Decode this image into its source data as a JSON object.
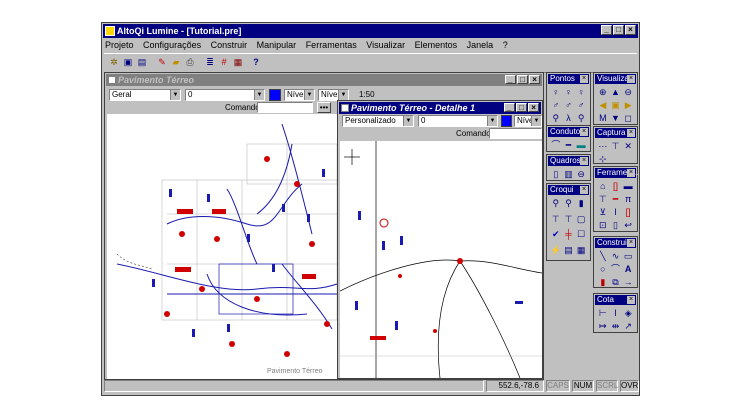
{
  "app": {
    "title": "AltoQi Lumine - [Tutorial.pre]"
  },
  "menu": [
    "Projeto",
    "Configurações",
    "Construir",
    "Manipular",
    "Ferramentas",
    "Visualizar",
    "Elementos",
    "Janela",
    "?"
  ],
  "toolbar_icons": [
    "new-icon",
    "open-icon",
    "save-icon",
    "pen-icon",
    "folder-icon",
    "print-icon",
    "layers-icon",
    "grid-icon",
    "properties-icon",
    "help-icon"
  ],
  "window1": {
    "title": "Pavimento Térreo",
    "layer_select": "Geral",
    "value_select": "0",
    "level1": "Nível",
    "level2": "Nível",
    "scale": "1:50",
    "command_label": "Comando",
    "floor_label": "Pavimento Térreo"
  },
  "window2": {
    "title": "Pavimento Térreo - Detalhe 1",
    "layer_select": "Personalizado",
    "value_select": "0",
    "level": "Nível",
    "command_label": "Comando"
  },
  "palettes": [
    {
      "title": "Pontos",
      "icons": [
        "point-icon",
        "point-icon",
        "point-icon",
        "point-icon",
        "point-icon",
        "point-icon",
        "point-icon",
        "point-icon",
        "point-icon",
        "point-icon",
        "point-icon",
        "point-icon"
      ]
    },
    {
      "title": "Visualiza...",
      "icons": [
        "zoom-in-icon",
        "arrow-up-icon",
        "zoom-out-icon",
        "arrow-left-icon",
        "zoom-window-icon",
        "arrow-right-icon",
        "pan-icon",
        "arrow-down-icon",
        "zoom-fit-icon"
      ]
    },
    {
      "title": "Condutos",
      "icons": [
        "conduit-icon",
        "conduit-icon",
        "conduit-icon"
      ]
    },
    {
      "title": "Captura",
      "icons": [
        "snap-icon",
        "snap-icon",
        "snap-icon"
      ]
    },
    {
      "title": "Quadros",
      "icons": [
        "panel-icon",
        "panel-icon",
        "panel-icon"
      ]
    },
    {
      "title": "Ferramen...",
      "icons": [
        "tool-icon",
        "tool-icon",
        "tool-icon",
        "tool-icon",
        "tool-icon",
        "tool-icon",
        "tool-icon",
        "tool-icon",
        "tool-icon",
        "tool-icon",
        "tool-icon",
        "tool-icon"
      ]
    },
    {
      "title": "Croqui",
      "icons": [
        "sketch-icon",
        "sketch-icon",
        "sketch-icon",
        "sketch-icon",
        "sketch-icon",
        "sketch-icon",
        "sketch-icon",
        "sketch-icon",
        "sketch-icon",
        "sketch-icon",
        "sketch-icon",
        "sketch-icon"
      ]
    },
    {
      "title": "Construir",
      "icons": [
        "line-icon",
        "polyline-icon",
        "rectangle-icon",
        "circle-icon",
        "arc-icon",
        "text-icon",
        "fill-icon",
        "copy-icon",
        "arrow-icon"
      ]
    },
    {
      "title": "Cota",
      "icons": [
        "dimension-icon",
        "dimension-icon",
        "dimension-icon",
        "dimension-icon",
        "dimension-icon",
        "dimension-icon"
      ]
    }
  ],
  "status": {
    "coords": "552.6,-78.6",
    "caps": "CAPS",
    "num": "NUM",
    "scrl": "SCRL",
    "ovr": "OVR"
  },
  "colors": {
    "title_active": "#000080",
    "title_inactive": "#808080",
    "face": "#c0c0c0",
    "drawing_blue": "#1a1ab0",
    "drawing_red": "#d00000"
  }
}
